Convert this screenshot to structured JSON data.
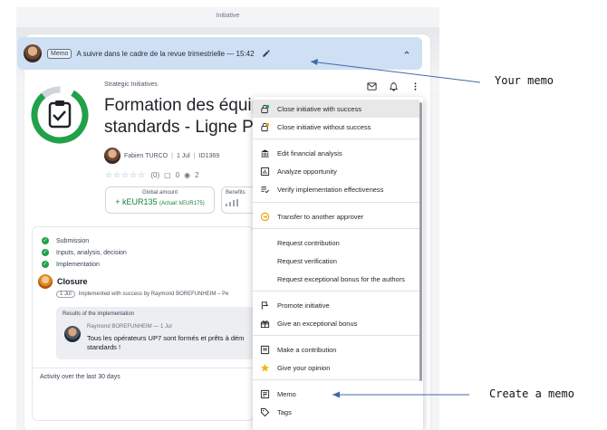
{
  "window_title": "Initiative",
  "memo": {
    "tag": "Memo",
    "text": "A suivre dans le cadre de la revue trimestrielle — 15:42",
    "edit_icon": "pencil-icon",
    "collapse_icon": "chevron-up-icon"
  },
  "header": {
    "category": "Strategic Initiatives",
    "title_line1": "Formation des équip",
    "title_line2": "standards - Ligne Pro",
    "icons": [
      "mail-icon",
      "bell-icon",
      "more-vertical-icon"
    ],
    "owner": "Fabien TURCO",
    "date": "1 Jul",
    "id": "ID1369",
    "rating_count": "(0)",
    "comments": "0",
    "views": "2",
    "global_amount_label": "Global amount",
    "global_amount_value": "+ kEUR135",
    "global_amount_actual": "(Actual: kEUR175)",
    "benefits_label": "Benefits"
  },
  "workflow": {
    "steps": [
      "Submission",
      "Inputs, analysis, decision",
      "Implementation"
    ],
    "closure_label": "Closure",
    "closure_date": "1 Jul",
    "closure_meta": "Implemented with success by Raymond BOREFUNHEIM – Pe",
    "results_title": "Results of the implementation",
    "results_author": "Raymond BOREFUNHEIM — 1 Jul",
    "results_text": "Tous les opérateurs UP7 sont formés et prêts à dém standards !",
    "activity_label": "Activity over the last 30 days"
  },
  "menu": {
    "items": [
      {
        "label": "Close initiative with success",
        "icon": "lock-success-icon"
      },
      {
        "label": "Close initiative without success",
        "icon": "lock-fail-icon"
      },
      {
        "label": "Edit financial analysis",
        "icon": "bank-icon"
      },
      {
        "label": "Analyze opportunity",
        "icon": "chart-box-icon"
      },
      {
        "label": "Verify implementation effectiveness",
        "icon": "checklist-icon"
      },
      {
        "label": "Transfer to another approver",
        "icon": "transfer-icon"
      },
      {
        "label": "Request contribution",
        "icon": ""
      },
      {
        "label": "Request verification",
        "icon": ""
      },
      {
        "label": "Request exceptional bonus for the authors",
        "icon": ""
      },
      {
        "label": "Promote initiative",
        "icon": "flag-icon"
      },
      {
        "label": "Give an exceptional bonus",
        "icon": "gift-icon"
      },
      {
        "label": "Make a contribution",
        "icon": "comment-box-icon"
      },
      {
        "label": "Give your opinion",
        "icon": "star-icon"
      },
      {
        "label": "Memo",
        "icon": "memo-icon"
      },
      {
        "label": "Tags",
        "icon": "tag-icon"
      }
    ]
  },
  "annotations": {
    "your_memo": "Your memo",
    "create_memo": "Create a memo"
  },
  "colors": {
    "memo_bg": "#cfe0f5",
    "success_green": "#22a04a",
    "accent_orange": "#f59e0b"
  }
}
